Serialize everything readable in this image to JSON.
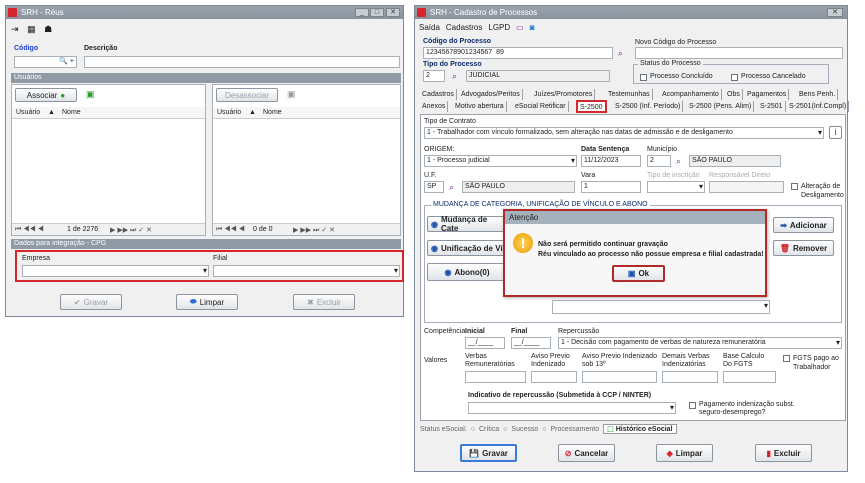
{
  "left_window": {
    "title": "SRH - Réus",
    "codigo_label": "Código",
    "descricao_label": "Descrição",
    "usuarios_header": "Usuários",
    "associar": "Associar",
    "desassociar": "Desassociar",
    "grid_cols": [
      "Usuário",
      "Nome"
    ],
    "pager_left": "1 de 2276",
    "pager_right": "0 de 0",
    "integracao_header": "Dados para integração - CPG",
    "empresa_label": "Empresa",
    "filial_label": "Filial",
    "gravar": "Gravar",
    "limpar": "Limpar",
    "excluir": "Excluir"
  },
  "right_window": {
    "title": "SRH - Cadastro de Processos",
    "menu": [
      "Saída",
      "Cadastros",
      "LGPD"
    ],
    "codigo_processo_label": "Código do Processo",
    "codigo_processo_value": "12345678901234567 89",
    "novo_codigo_label": "Novo Código do Processo",
    "tipo_processo_label": "Tipo do Processo",
    "tipo_code": "2",
    "tipo_desc": "JUDICIAL",
    "status_label": "Status do Processo",
    "concluido": "Processo Concluído",
    "cancelado": "Processo Cancelado",
    "tabs_row1": [
      "Cadastros",
      "Advogados/Peritos",
      "Juízes/Promotores",
      "Testemunhas",
      "Acompanhamento",
      "Obs",
      "Pagamentos",
      "Bens Penh."
    ],
    "tabs_row2": [
      "Anexos",
      "Motivo abertura",
      "eSocial Retificar",
      "S-2500",
      "S-2500 (Inf. Período)",
      "S-2500 (Pens. Alim)",
      "S-2501",
      "S-2501(Inf.Compl)"
    ],
    "tipo_contrato_label": "Tipo de Contrato",
    "tipo_contrato_value": "1 - Trabalhador com vínculo formalizado, sem alteração nas datas de admissão e de desligamento",
    "origem_label": "ORIGEM:",
    "origem_value": "1 - Processo judicial",
    "data_sentenca_label": "Data Sentença",
    "data_sentenca_value": "11/12/2023",
    "municipio_label": "Município",
    "municipio_code": "2",
    "municipio_name": "SÃO PAULO",
    "uf_label": "U.F.",
    "uf_value": "SP",
    "uf_name": "SÃO PAULO",
    "vara_label": "Vara",
    "vara_value": "1",
    "tipo_inscricao_label": "Tipo de inscrição",
    "responsavel_label": "Responsável Direto",
    "alteracao_label": "Alteração de Desligamento",
    "mudanca_legend": "MUDANÇA DE CATEGORIA, UNIFICAÇÃO DE VÍNCULO E ABONO",
    "mudanca_btn": "Mudança de Cate",
    "unificacao_btn": "Unificação de Ví",
    "abono_btn": "Abono(0)",
    "adicionar": "Adicionar",
    "remover": "Remover",
    "competencia_label": "Competência",
    "inicial_label": "Inicial",
    "final_label": "Final",
    "inicial_value": "__/____",
    "final_value": "__/____",
    "repercussao_label": "Repercussão",
    "repercussao_value": "1 - Decisão com pagamento de verbas de natureza remuneratória",
    "valores_label": "Valores",
    "verbas_label": "Verbas Remuneratórias",
    "aviso_label": "Aviso Previo Indenizado",
    "aviso13_label": "Aviso Previo Indenizado sob 13º",
    "demais_label": "Demais Verbas Indenizatórias",
    "base_label": "Base Calculo Do FGTS",
    "fgts_label": "FGTS pago ao Trabalhador",
    "indicativo_label": "Indicativo de repercussão (Submetida à CCP / NINTER)",
    "pagamento_label": "Pagamento indenização subst. seguro-desemprego?",
    "status_esocial_label": "Status eSocial:",
    "st_critica": "Crítica",
    "st_sucesso": "Sucesso",
    "st_processamento": "Processamento",
    "historico": "Histórico eSocial",
    "gravar": "Gravar",
    "cancelar": "Cancelar",
    "limpar": "Limpar",
    "excluir": "Excluir"
  },
  "dialog": {
    "title": "Atenção",
    "line1": "Não será permitido continuar gravação",
    "line2": "Réu vinculado ao processo não possue empresa e filial cadastrada!",
    "ok": "Ok"
  },
  "colors": {
    "accent_red": "#d6262d",
    "title_bar": "#8f9aa5",
    "link_blue": "#0b2a6b"
  }
}
